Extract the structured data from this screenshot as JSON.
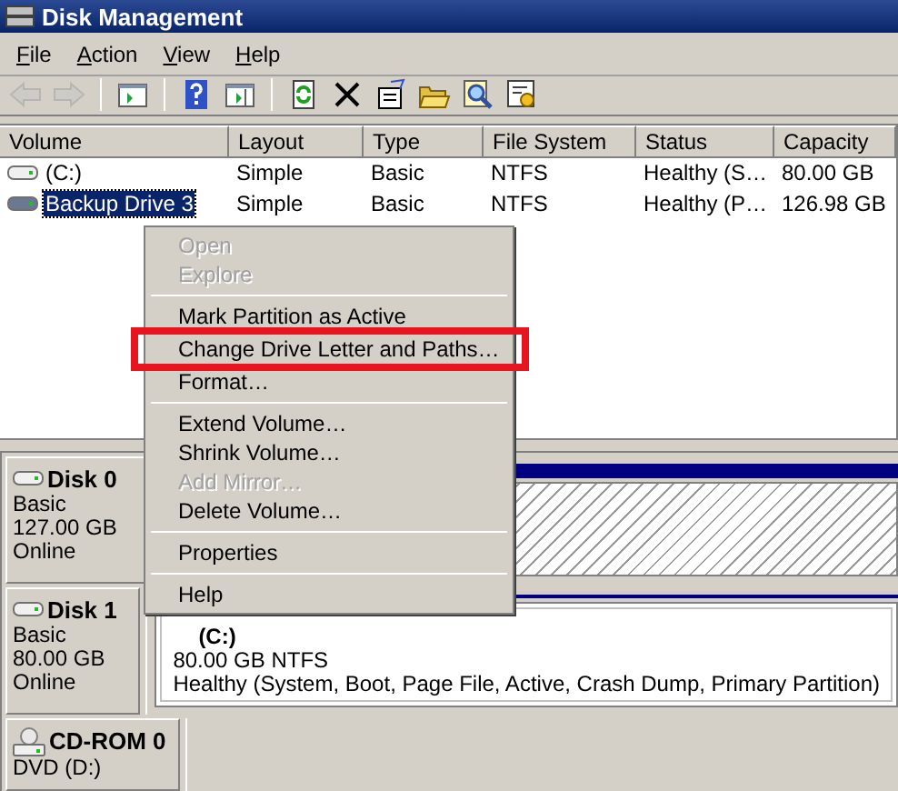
{
  "window": {
    "title": "Disk Management"
  },
  "menu": [
    "File",
    "Action",
    "View",
    "Help"
  ],
  "toolbar": [
    {
      "kind": "back",
      "disabled": true
    },
    {
      "kind": "forward",
      "disabled": true
    },
    {
      "kind": "separator"
    },
    {
      "kind": "tree",
      "disabled": false
    },
    {
      "kind": "separator"
    },
    {
      "kind": "help",
      "disabled": false
    },
    {
      "kind": "pane",
      "disabled": false
    },
    {
      "kind": "separator"
    },
    {
      "kind": "refresh",
      "disabled": false
    },
    {
      "kind": "delete",
      "disabled": false
    },
    {
      "kind": "properties",
      "disabled": false
    },
    {
      "kind": "folder",
      "disabled": false
    },
    {
      "kind": "search",
      "disabled": false
    },
    {
      "kind": "settings",
      "disabled": false
    }
  ],
  "table": {
    "columns": [
      "Volume",
      "Layout",
      "Type",
      "File System",
      "Status",
      "Capacity"
    ],
    "rows": [
      {
        "volume": "(C:)",
        "layout": "Simple",
        "type": "Basic",
        "file_system": "NTFS",
        "status": "Healthy (S…",
        "capacity": "80.00 GB",
        "selected": false
      },
      {
        "volume": "Backup Drive 3",
        "layout": "Simple",
        "type": "Basic",
        "file_system": "NTFS",
        "status": "Healthy (P…",
        "capacity": "126.98 GB",
        "selected": true
      }
    ]
  },
  "disks": [
    {
      "kind": "disk",
      "name": "Disk 0",
      "type": "Basic",
      "size": "127.00 GB",
      "status": "Online",
      "partition": {
        "selected": true
      }
    },
    {
      "kind": "disk",
      "name": "Disk 1",
      "type": "Basic",
      "size": "80.00 GB",
      "status": "Online",
      "partition": {
        "selected": false,
        "label": "(C:)",
        "detail": "80.00 GB NTFS",
        "status": "Healthy (System, Boot, Page File, Active, Crash Dump, Primary Partition)"
      }
    },
    {
      "kind": "cdrom",
      "name": "CD-ROM 0",
      "type": "DVD (D:)"
    }
  ],
  "context_menu": [
    {
      "kind": "item",
      "label": "Open",
      "disabled": true,
      "highlighted": false
    },
    {
      "kind": "item",
      "label": "Explore",
      "disabled": true,
      "highlighted": false
    },
    {
      "kind": "separator"
    },
    {
      "kind": "item",
      "label": "Mark Partition as Active",
      "disabled": false,
      "highlighted": false
    },
    {
      "kind": "item",
      "label": "Change Drive Letter and Paths…",
      "disabled": false,
      "highlighted": true
    },
    {
      "kind": "item",
      "label": "Format…",
      "disabled": false,
      "highlighted": false
    },
    {
      "kind": "separator"
    },
    {
      "kind": "item",
      "label": "Extend Volume…",
      "disabled": false,
      "highlighted": false
    },
    {
      "kind": "item",
      "label": "Shrink Volume…",
      "disabled": false,
      "highlighted": false
    },
    {
      "kind": "item",
      "label": "Add Mirror…",
      "disabled": true,
      "highlighted": false
    },
    {
      "kind": "item",
      "label": "Delete Volume…",
      "disabled": false,
      "highlighted": false
    },
    {
      "kind": "separator"
    },
    {
      "kind": "item",
      "label": "Properties",
      "disabled": false,
      "highlighted": false
    },
    {
      "kind": "separator"
    },
    {
      "kind": "item",
      "label": "Help",
      "disabled": false,
      "highlighted": false
    }
  ]
}
